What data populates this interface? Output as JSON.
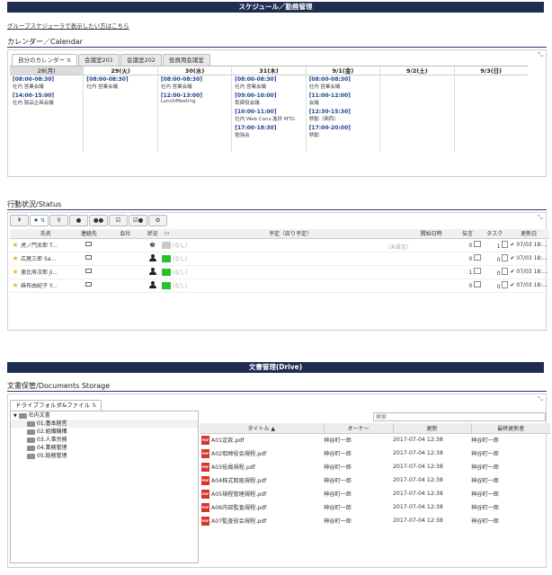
{
  "schedule": {
    "header": "スケジュール／勤務管理",
    "group_link": "グループスケジューラで表示したい方はこちら",
    "section_title": "カレンダー／Calendar",
    "tabs": [
      {
        "label": "自分のカレンダー",
        "active": true
      },
      {
        "label": "会議室201",
        "active": false
      },
      {
        "label": "会議室202",
        "active": false
      },
      {
        "label": "役員用会議室",
        "active": false
      }
    ],
    "days": [
      {
        "label": "28(月)",
        "today": true,
        "events": [
          {
            "time": "[08:00-08:30]",
            "desc": "社内 営業会議"
          },
          {
            "time": "[14:00-15:00]",
            "desc": "社内 製品企画会議"
          }
        ]
      },
      {
        "label": "29(火)",
        "today": false,
        "events": [
          {
            "time": "[08:00-08:30]",
            "desc": "社内 営業会議"
          }
        ]
      },
      {
        "label": "30(水)",
        "today": false,
        "events": [
          {
            "time": "[08:00-08:30]",
            "desc": "社内 営業会議"
          },
          {
            "time": "[12:00-13:00]",
            "desc": "LunchMeeting"
          }
        ]
      },
      {
        "label": "31(木)",
        "today": false,
        "events": [
          {
            "time": "[08:00-08:30]",
            "desc": "社内 営業会議"
          },
          {
            "time": "[09:00-10:00]",
            "desc": "取締役会議"
          },
          {
            "time": "[10:00-11:00]",
            "desc": "社内 Web Conv.進捗 MTG"
          },
          {
            "time": "[17:00-18:30]",
            "desc": "勉強会"
          }
        ]
      },
      {
        "label": "9/1(金)",
        "today": false,
        "events": [
          {
            "time": "[08:00-08:30]",
            "desc": "社内 営業会議"
          },
          {
            "time": "[11:00-12:00]",
            "desc": "会議"
          },
          {
            "time": "[12:30-15:30]",
            "desc": "移動（関西）"
          },
          {
            "time": "[17:00-20:00]",
            "desc": "移動"
          }
        ]
      },
      {
        "label": "9/2(土)",
        "today": false,
        "events": []
      },
      {
        "label": "9/3(日)",
        "today": false,
        "events": []
      }
    ]
  },
  "status": {
    "section_title": "行動状況/Status",
    "columns": [
      "氏名",
      "連絡先",
      "会社",
      "状況",
      "予定（戻り予定）",
      "開始日時",
      "伝言",
      "タスク",
      "更新日"
    ],
    "rows": [
      {
        "name": "虎ノ門太郎 T...",
        "plan": "(なし)",
        "note": "(未設定)",
        "msg": "0",
        "task": "1",
        "updated": "07/03 18:..."
      },
      {
        "name": "広尾三郎 Sa...",
        "plan": "(なし)",
        "note": "",
        "msg": "0",
        "task": "0",
        "updated": "07/03 18:..."
      },
      {
        "name": "恵比寿次郎 Ji...",
        "plan": "(なし)",
        "note": "",
        "msg": "1",
        "task": "0",
        "updated": "07/03 18:..."
      },
      {
        "name": "麻布由紀子 Y...",
        "plan": "(なし)",
        "note": "",
        "msg": "0",
        "task": "0",
        "updated": "07/03 18:..."
      }
    ]
  },
  "drive": {
    "header": "文書管理(Drive)",
    "section_title": "文書保管/Documents Storage",
    "tab_label": "ドライブフォルダ&ファイル",
    "search_placeholder": "検索",
    "tree_root": "社内文書",
    "folders": [
      "01.基本経営",
      "02.組織機構",
      "03.人事労務",
      "04.業務管理",
      "05.総務管理"
    ],
    "columns": [
      "タイトル ▲",
      "オーナー",
      "更新",
      "最終更新者"
    ],
    "files": [
      {
        "title": "A01定款.pdf",
        "owner": "神谷町一郎",
        "updated": "2017-07-04 12:38",
        "editor": "神谷町一郎"
      },
      {
        "title": "A02取締役会規程.pdf",
        "owner": "神谷町一郎",
        "updated": "2017-07-04 12:38",
        "editor": "神谷町一郎"
      },
      {
        "title": "A03役員規程.pdf",
        "owner": "神谷町一郎",
        "updated": "2017-07-04 12:38",
        "editor": "神谷町一郎"
      },
      {
        "title": "A04株式取扱規程.pdf",
        "owner": "神谷町一郎",
        "updated": "2017-07-04 12:38",
        "editor": "神谷町一郎"
      },
      {
        "title": "A05規程管理規程.pdf",
        "owner": "神谷町一郎",
        "updated": "2017-07-04 12:38",
        "editor": "神谷町一郎"
      },
      {
        "title": "A06内部監査規程.pdf",
        "owner": "神谷町一郎",
        "updated": "2017-07-04 12:38",
        "editor": "神谷町一郎"
      },
      {
        "title": "A07監査役会規程.pdf",
        "owner": "神谷町一郎",
        "updated": "2017-07-04 12:38",
        "editor": "神谷町一郎"
      }
    ]
  }
}
